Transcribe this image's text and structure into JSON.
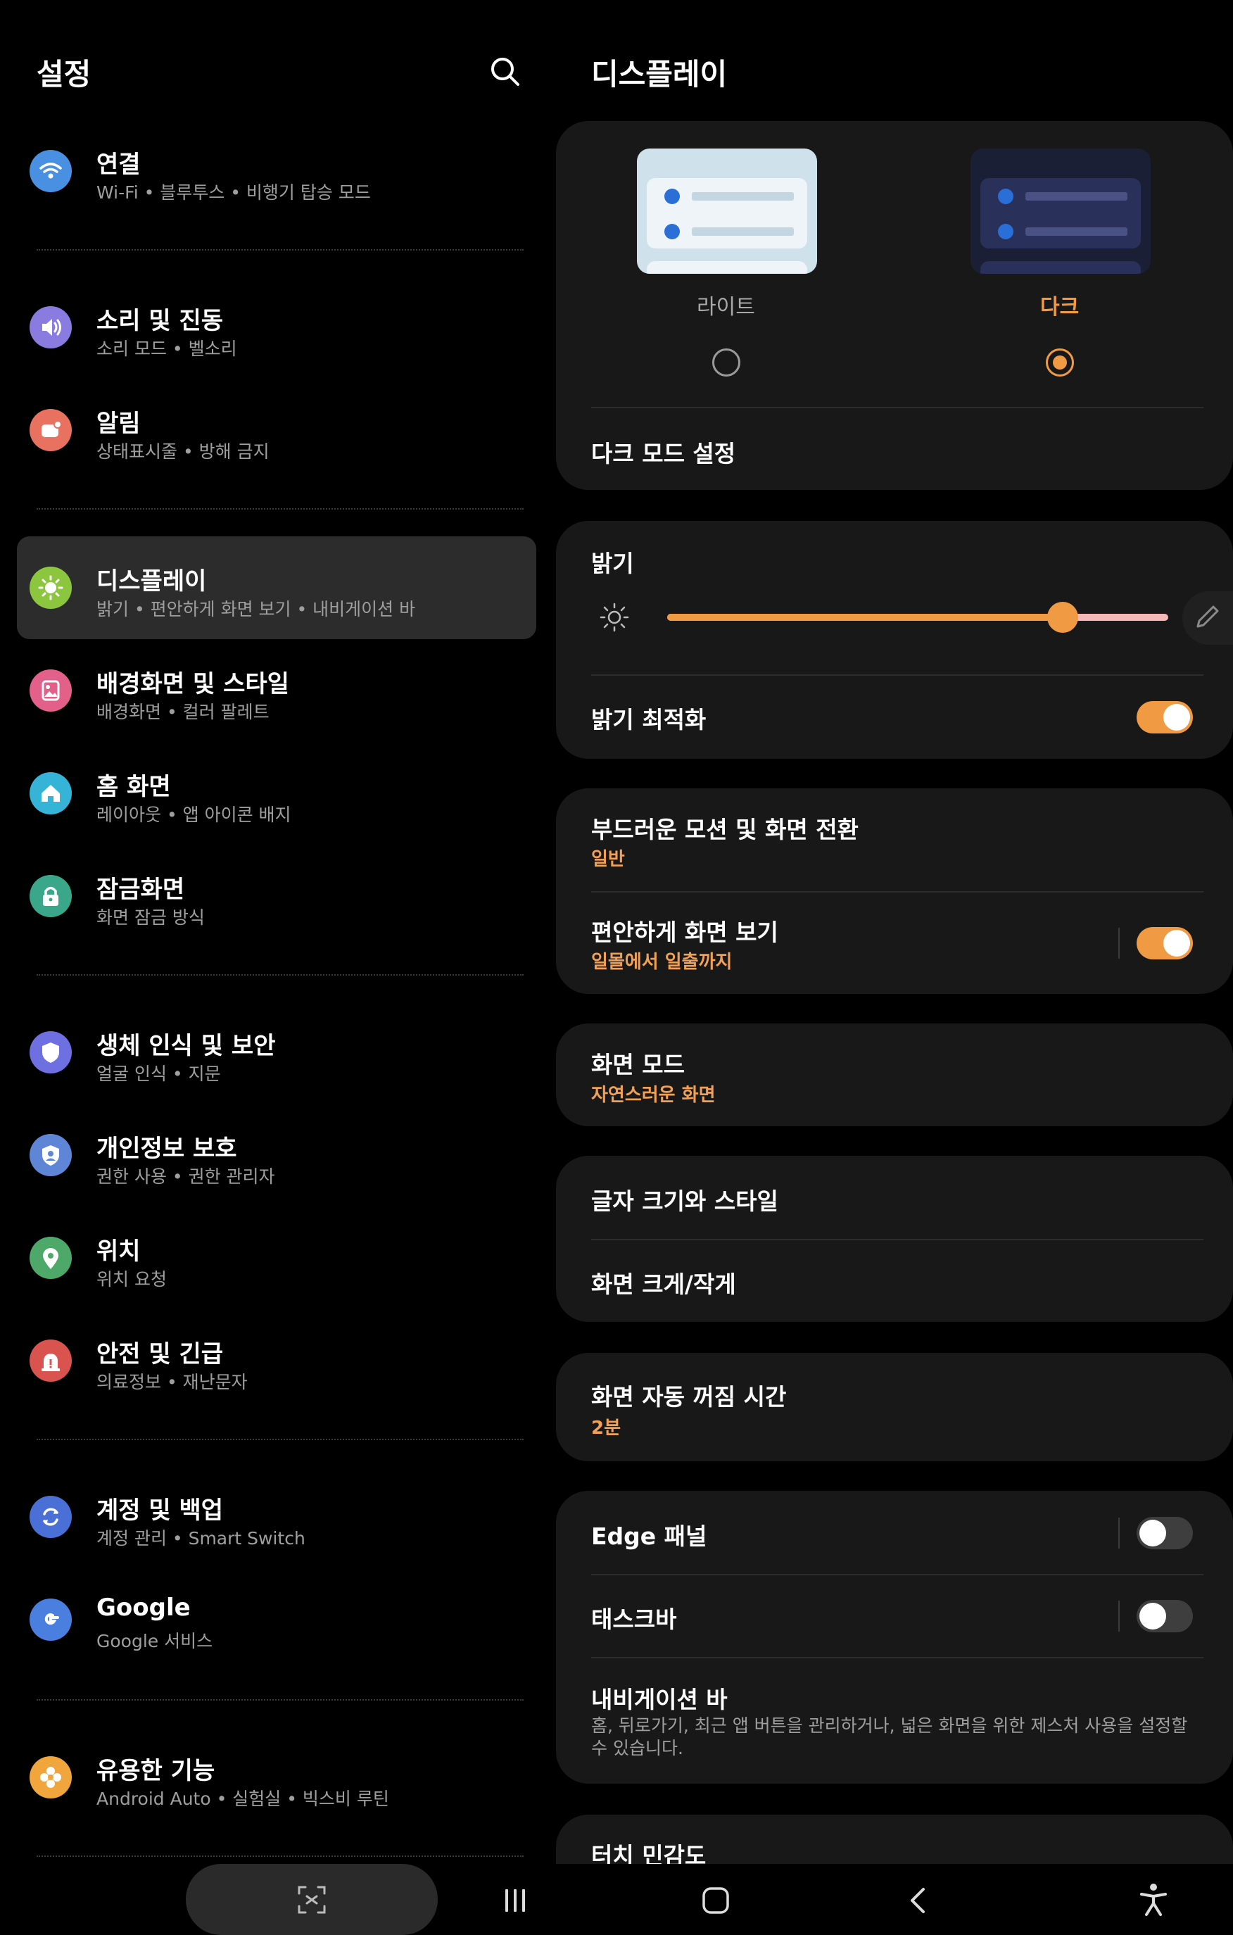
{
  "left": {
    "title": "설정",
    "items": [
      {
        "title": "연결",
        "subtitle": "Wi-Fi • 블루투스 • 비행기 탑승 모드",
        "icon": "wifi-icon",
        "color": "#4a90e2"
      },
      {
        "title": "소리 및 진동",
        "subtitle": "소리 모드 • 벨소리",
        "icon": "speaker-icon",
        "color": "#8a7be0"
      },
      {
        "title": "알림",
        "subtitle": "상태표시줄 • 방해 금지",
        "icon": "notification-icon",
        "color": "#e8725f"
      },
      {
        "title": "디스플레이",
        "subtitle": "밝기 • 편안하게 화면 보기 • 내비게이션 바",
        "icon": "sun-icon",
        "color": "#8cc63f"
      },
      {
        "title": "배경화면 및 스타일",
        "subtitle": "배경화면 • 컬러 팔레트",
        "icon": "wallpaper-icon",
        "color": "#e2608a"
      },
      {
        "title": "홈 화면",
        "subtitle": "레이아웃 • 앱 아이콘 배지",
        "icon": "home-icon",
        "color": "#35b4d8"
      },
      {
        "title": "잠금화면",
        "subtitle": "화면 잠금 방식",
        "icon": "lock-icon",
        "color": "#3aa68a"
      },
      {
        "title": "생체 인식 및 보안",
        "subtitle": "얼굴 인식 • 지문",
        "icon": "shield-icon",
        "color": "#6e6fe0"
      },
      {
        "title": "개인정보 보호",
        "subtitle": "권한 사용 • 권한 관리자",
        "icon": "privacy-icon",
        "color": "#5f86d6"
      },
      {
        "title": "위치",
        "subtitle": "위치 요청",
        "icon": "location-icon",
        "color": "#4ea86a"
      },
      {
        "title": "안전 및 긴급",
        "subtitle": "의료정보 • 재난문자",
        "icon": "emergency-icon",
        "color": "#d9534f"
      },
      {
        "title": "계정 및 백업",
        "subtitle": "계정 관리 • Smart Switch",
        "icon": "sync-icon",
        "color": "#4a6fd6"
      },
      {
        "title": "Google",
        "subtitle": "Google 서비스",
        "icon": "google-icon",
        "color": "#4a7fe0"
      },
      {
        "title": "유용한 기능",
        "subtitle": "Android Auto • 실험실 • 빅스비 루틴",
        "icon": "flower-icon",
        "color": "#f0a63c"
      }
    ]
  },
  "right": {
    "title": "디스플레이",
    "theme": {
      "light_label": "라이트",
      "dark_label": "다크",
      "selected": "dark"
    },
    "dark_mode_settings": "다크 모드 설정",
    "brightness": {
      "label": "밝기",
      "value": 0.79
    },
    "adaptive_brightness": {
      "label": "밝기 최적화",
      "on": true
    },
    "motion": {
      "label": "부드러운 모션 및 화면 전환",
      "value": "일반"
    },
    "eye_comfort": {
      "label": "편안하게 화면 보기",
      "value": "일몰에서 일출까지",
      "on": true
    },
    "screen_mode": {
      "label": "화면 모드",
      "value": "자연스러운 화면"
    },
    "font_size": {
      "label": "글자 크기와 스타일"
    },
    "screen_zoom": {
      "label": "화면 크게/작게"
    },
    "timeout": {
      "label": "화면 자동 꺼짐 시간",
      "value": "2분"
    },
    "edge_panel": {
      "label": "Edge 패널",
      "on": false
    },
    "taskbar": {
      "label": "태스크바",
      "on": false
    },
    "navigation_bar": {
      "label": "내비게이션 바",
      "desc": "홈, 뒤로가기, 최근 앱 버튼을 관리하거나, 넓은 화면을 위한 제스처 사용을 설정할 수 있습니다."
    },
    "touch_sensitivity": {
      "label": "터치 민감도"
    }
  },
  "colors": {
    "accent": "#f09a44",
    "card": "#181818",
    "selected": "#2c2c2c"
  },
  "nav": {
    "icons": [
      "screenshot-icon",
      "recents-icon",
      "home-icon",
      "back-icon",
      "accessibility-icon"
    ]
  }
}
